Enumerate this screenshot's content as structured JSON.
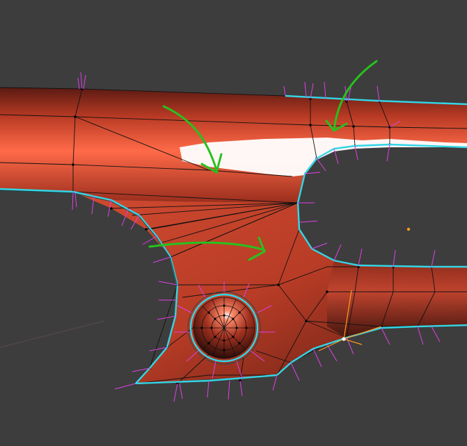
{
  "viewport": {
    "background": "#3d3d3d",
    "mesh_face_color": "#c8432a",
    "mesh_highlight_color": "#ffffff",
    "edge_color": "#111111",
    "seam_color": "#33d6e6",
    "normal_color": "#e040e8",
    "annotation_color": "#26c21e",
    "active_vertex_color": "#ff9a1f"
  },
  "icons": {
    "origin": "origin-dot-icon",
    "arrows": [
      "green-arrow-icon",
      "green-arrow-icon",
      "green-arrow-icon"
    ]
  }
}
